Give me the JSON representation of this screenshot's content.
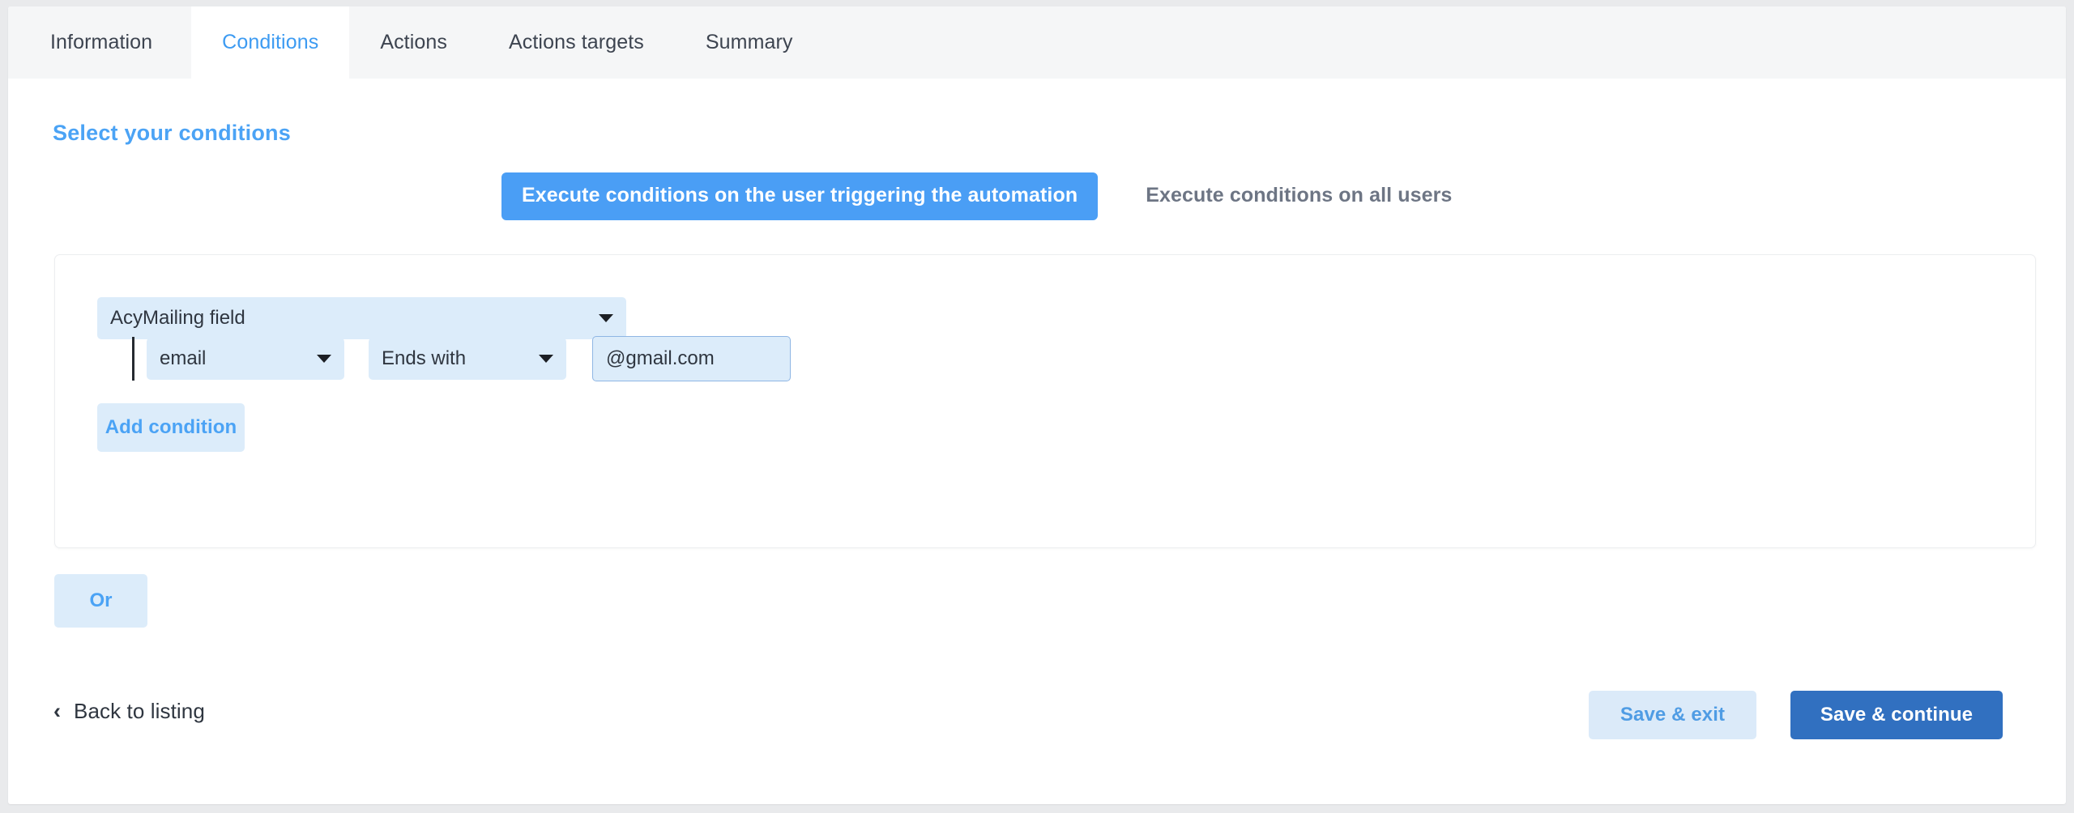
{
  "tabs": [
    {
      "label": "Information",
      "active": false
    },
    {
      "label": "Conditions",
      "active": true
    },
    {
      "label": "Actions",
      "active": false
    },
    {
      "label": "Actions targets",
      "active": false
    },
    {
      "label": "Summary",
      "active": false
    }
  ],
  "heading": "Select your conditions",
  "scope_toggle": {
    "active_label": "Execute conditions on the user triggering the automation",
    "inactive_label": "Execute conditions on all users"
  },
  "condition_card": {
    "field_group": {
      "value": "AcyMailing field",
      "icon": "chevron-down-icon"
    },
    "condition_row": {
      "column": {
        "value": "email",
        "icon": "chevron-down-icon"
      },
      "operator": {
        "value": "Ends with",
        "icon": "chevron-down-icon"
      },
      "value": {
        "value": "@gmail.com",
        "placeholder": ""
      }
    },
    "add_condition_label": "Add condition"
  },
  "or_button_label": "Or",
  "footer": {
    "back_icon": "chevron-left-icon",
    "back_label": "Back to listing",
    "save_exit_label": "Save & exit",
    "save_continue_label": "Save & continue"
  },
  "colors": {
    "accent_blue": "#4ba3f5",
    "toggle_active_blue": "#4a9ef5",
    "primary_button_blue": "#3170c0",
    "field_fill": "#dcecfa",
    "tabbar_gray": "#f5f6f7",
    "page_gray": "#e9eaec",
    "text_dark": "#2f3640"
  }
}
